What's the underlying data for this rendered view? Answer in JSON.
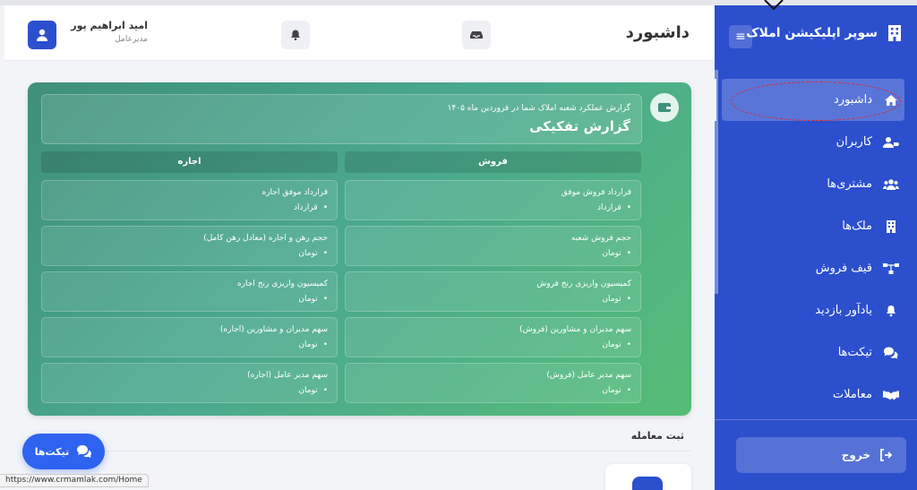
{
  "app": {
    "brand_title": "سوپر اپلیکیشن املاک"
  },
  "header": {
    "page_title": "داشبورد",
    "user_name": "امید ابراهیم پور",
    "user_role": "مدیرعامل"
  },
  "sidebar": {
    "items": [
      {
        "label": "داشبورد",
        "icon": "home-icon",
        "active": true
      },
      {
        "label": "کاربران",
        "icon": "user-tag-icon"
      },
      {
        "label": "مشتری‌ها",
        "icon": "users-icon"
      },
      {
        "label": "ملک‌ها",
        "icon": "building-icon"
      },
      {
        "label": "قیف فروش",
        "icon": "funnel-icon"
      },
      {
        "label": "یادآور بازدید",
        "icon": "bell-icon"
      },
      {
        "label": "تیکت‌ها",
        "icon": "comments-icon"
      },
      {
        "label": "معاملات",
        "icon": "handshake-icon"
      }
    ],
    "logout_label": "خروج"
  },
  "report": {
    "subtitle": "گزارش عملکرد شعبه املاک شما در فروردین ماه ۱۴۰۵",
    "title": "گزارش تفکیکی",
    "columns": [
      "فروش",
      "اجاره"
    ],
    "sales_rows": [
      {
        "title": "قرارداد فروش موفق",
        "value": "قرارداد"
      },
      {
        "title": "حجم فروش شعبه",
        "value": "تومان"
      },
      {
        "title": "کمیسیون واریزی رنج فروش",
        "value": "تومان"
      },
      {
        "title": "سهم مدیران و مشاورین (فروش)",
        "value": "تومان"
      },
      {
        "title": "سهم مدیر عامل (فروش)",
        "value": "تومان"
      }
    ],
    "rent_rows": [
      {
        "title": "قرارداد موفق اجاره",
        "value": "قرارداد"
      },
      {
        "title": "حجم رهن و اجاره (معادل رهن کامل)",
        "value": "تومان"
      },
      {
        "title": "کمیسیون واریزی رنج اجاره",
        "value": "تومان"
      },
      {
        "title": "سهم مدیران و مشاورین (اجاره)",
        "value": "تومان"
      },
      {
        "title": "سهم مدیر عامل (اجاره)",
        "value": "تومان"
      }
    ]
  },
  "section_title": "ثبت معامله",
  "fab_label": "تیکت‌ها",
  "status_url": "https://www.crmamlak.com/Home",
  "colors": {
    "primary": "#2c4fce",
    "report_start": "#3f8f7a",
    "report_end": "#55bd77",
    "annotation": "#e02a2a"
  }
}
